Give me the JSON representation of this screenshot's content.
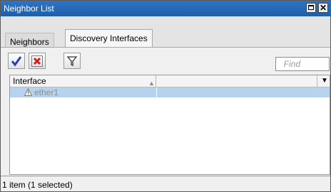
{
  "window": {
    "title": "Neighbor List"
  },
  "tabs": [
    {
      "label": "Neighbors",
      "active": false
    },
    {
      "label": "Discovery Interfaces",
      "active": true
    }
  ],
  "toolbar": {
    "enable_icon": "check-icon",
    "disable_icon": "x-icon",
    "filter_icon": "filter-icon",
    "find_placeholder": "Find",
    "accent_check": "#1f3fbf",
    "accent_x": "#d21b1b"
  },
  "table": {
    "columns": [
      "Interface"
    ],
    "rows": [
      {
        "interface": "ether1",
        "selected": true,
        "disabled_icon": "warning-triangle-icon"
      }
    ],
    "selected_row_color": "#b6d2ee"
  },
  "status": {
    "text": "1 item (1 selected)"
  },
  "colors": {
    "titlebar": "#2f74c3"
  }
}
